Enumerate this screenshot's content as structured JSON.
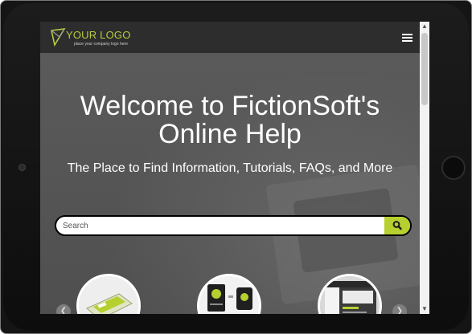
{
  "header": {
    "logo_text": "YOUR LOGO",
    "logo_tagline": "place your company logo here",
    "menu_icon": "hamburger-menu-icon"
  },
  "hero": {
    "title": "Welcome to FictionSoft's Online Help",
    "subtitle": "The Place to Find Information, Tutorials, FAQs, and More"
  },
  "search": {
    "placeholder": "Search",
    "button_icon": "search-icon"
  },
  "carousel": {
    "prev_icon": "chevron-left-icon",
    "next_icon": "chevron-right-icon",
    "items": [
      {
        "icon": "software-box-thumbnail"
      },
      {
        "icon": "document-book-thumbnail"
      },
      {
        "icon": "app-window-thumbnail"
      }
    ]
  },
  "colors": {
    "accent": "#b7cf2f",
    "topbar": "#2d2d2d",
    "hero_bg": "#555555"
  }
}
